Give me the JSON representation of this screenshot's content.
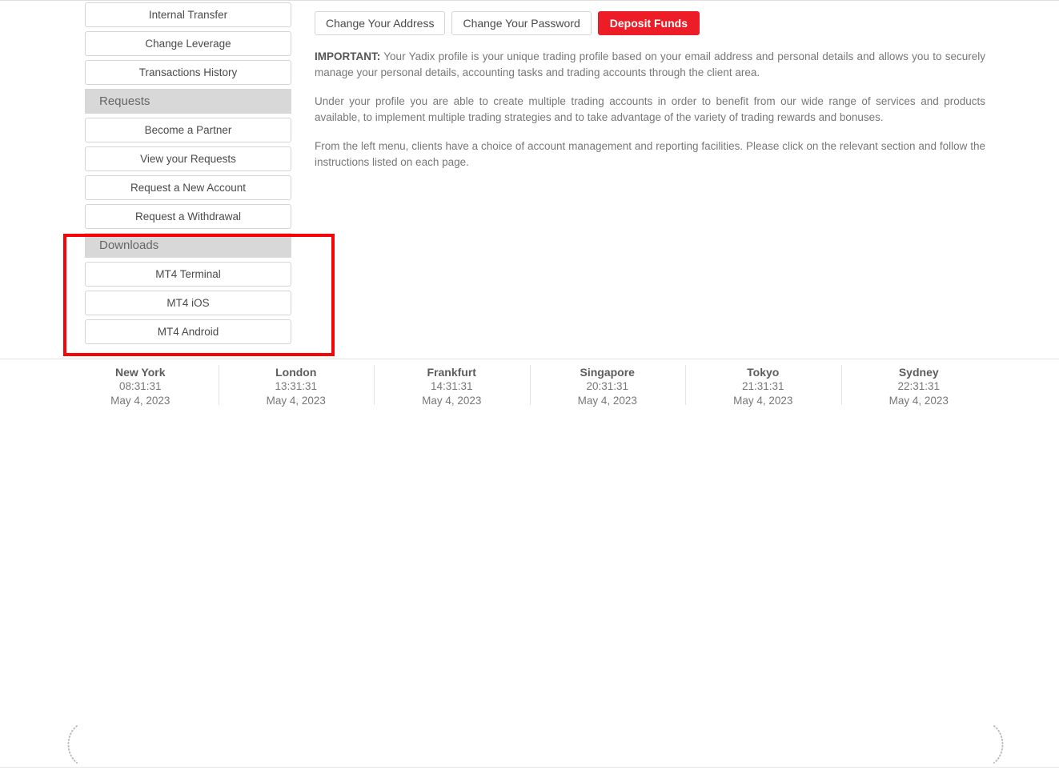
{
  "sidebar": {
    "items": [
      {
        "type": "button",
        "label": "Internal Transfer"
      },
      {
        "type": "button",
        "label": "Change Leverage"
      },
      {
        "type": "button",
        "label": "Transactions History"
      },
      {
        "type": "header",
        "label": "Requests"
      },
      {
        "type": "button",
        "label": "Become a Partner"
      },
      {
        "type": "button",
        "label": "View your Requests"
      },
      {
        "type": "button",
        "label": "Request a New Account"
      },
      {
        "type": "button",
        "label": "Request a Withdrawal"
      },
      {
        "type": "header",
        "label": "Downloads"
      },
      {
        "type": "button",
        "label": "MT4 Terminal"
      },
      {
        "type": "button",
        "label": "MT4 iOS"
      },
      {
        "type": "button",
        "label": "MT4 Android"
      }
    ]
  },
  "annotation": {
    "color": "#f50505",
    "target": "downloads-section"
  },
  "main": {
    "actions": [
      {
        "label": "Change Your Address",
        "style": "default"
      },
      {
        "label": "Change Your Password",
        "style": "default"
      },
      {
        "label": "Deposit Funds",
        "style": "primary"
      }
    ],
    "paragraphs": {
      "p1_lead": "IMPORTANT:",
      "p1": " Your Yadix profile is your unique trading profile based on your email address and personal details and allows you to securely manage your personal details, accounting tasks and trading accounts through the client area.",
      "p2": "Under your profile you are able to create multiple trading accounts in order to benefit from our wide range of services and products available, to implement multiple trading strategies and to take advantage of the variety of trading rewards and bonuses.",
      "p3": "From the left menu, clients have a choice of account management and reporting facilities. Please click on the relevant section and follow the instructions listed on each page."
    }
  },
  "footer": {
    "clocks": [
      {
        "city": "New York",
        "time": "08:31:31",
        "date": "May 4, 2023"
      },
      {
        "city": "London",
        "time": "13:31:31",
        "date": "May 4, 2023"
      },
      {
        "city": "Frankfurt",
        "time": "14:31:31",
        "date": "May 4, 2023"
      },
      {
        "city": "Singapore",
        "time": "20:31:31",
        "date": "May 4, 2023"
      },
      {
        "city": "Tokyo",
        "time": "21:31:31",
        "date": "May 4, 2023"
      },
      {
        "city": "Sydney",
        "time": "22:31:31",
        "date": "May 4, 2023"
      }
    ]
  },
  "theme": {
    "accent_red": "#ec1d26",
    "header_gray": "#d8d8d8",
    "border_gray": "#d5d5d5",
    "text_gray": "#777777"
  }
}
